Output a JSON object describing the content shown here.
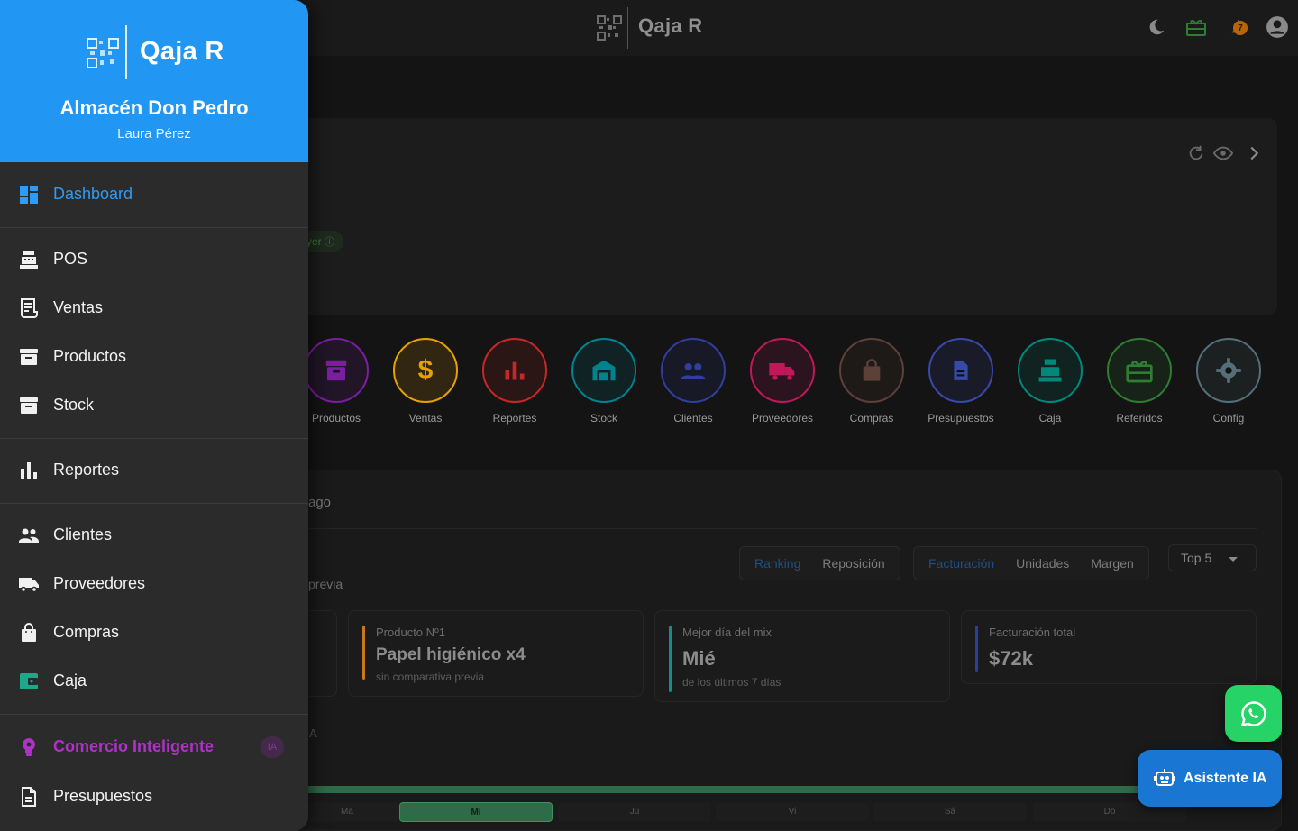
{
  "topbar": {
    "title": "Qaja R",
    "icons": [
      "moon-icon",
      "gift-icon",
      "bell-icon",
      "account-icon"
    ],
    "notifications_count": "7"
  },
  "background": {
    "summary_card": {
      "comparison_pill": "yer",
      "controls": [
        "refresh-icon",
        "eye-icon",
        "chevron-right-icon"
      ]
    },
    "quick_access": [
      {
        "label": "Productos",
        "color": "#7b1fa2"
      },
      {
        "label": "Ventas",
        "color": "#e6a100"
      },
      {
        "label": "Reportes",
        "color": "#c62828"
      },
      {
        "label": "Stock",
        "color": "#00838f"
      },
      {
        "label": "Clientes",
        "color": "#303f9f"
      },
      {
        "label": "Proveedores",
        "color": "#c2185b"
      },
      {
        "label": "Compras",
        "color": "#5d4037"
      },
      {
        "label": "Presupuestos",
        "color": "#3949ab"
      },
      {
        "label": "Caja",
        "color": "#00897b"
      },
      {
        "label": "Referidos",
        "color": "#2e7d32"
      },
      {
        "label": "Config",
        "color": "#546e7a"
      }
    ],
    "analytics": {
      "title_fragment": "ago",
      "subtitle_fragment": "previa",
      "view_tabs": [
        {
          "label": "Ranking",
          "active": true
        },
        {
          "label": "Reposición",
          "active": false
        }
      ],
      "metric_tabs": [
        {
          "label": "Facturación",
          "active": true
        },
        {
          "label": "Unidades",
          "active": false
        },
        {
          "label": "Margen",
          "active": false
        }
      ],
      "top_select": "Top 5",
      "kpis": [
        {
          "label": "Producto Nº1",
          "value": "Papel higiénico x4",
          "note": "sin comparativa previa",
          "accent": "#c77a1a"
        },
        {
          "label": "Mejor día del mix",
          "value": "Mié",
          "note": "de los últimos 7 días",
          "accent": "#1a8a8a"
        },
        {
          "label": "Facturación total",
          "value": "$72k",
          "note": "",
          "accent": "#2a3fa0"
        }
      ],
      "stray_letter": "A",
      "days": [
        {
          "label": "Ma",
          "active": false
        },
        {
          "label": "Mi",
          "active": true
        },
        {
          "label": "Ju",
          "active": false
        },
        {
          "label": "Vi",
          "active": false
        },
        {
          "label": "Sá",
          "active": false
        },
        {
          "label": "Do",
          "active": false
        }
      ]
    }
  },
  "fab": {
    "whatsapp_icon": "whatsapp-icon",
    "assistant_label": "Asistente IA"
  },
  "drawer": {
    "brand": "Qaja R",
    "store_name": "Almacén Don Pedro",
    "user_name": "Laura Pérez",
    "items": [
      {
        "label": "Dashboard",
        "icon": "dashboard-icon",
        "active": true
      },
      {
        "label": "POS",
        "icon": "register-icon"
      },
      {
        "label": "Ventas",
        "icon": "receipt-icon"
      },
      {
        "label": "Productos",
        "icon": "archive-icon"
      },
      {
        "label": "Stock",
        "icon": "archive-icon"
      },
      {
        "label": "Reportes",
        "icon": "bar-chart-icon"
      },
      {
        "label": "Clientes",
        "icon": "people-icon"
      },
      {
        "label": "Proveedores",
        "icon": "truck-icon"
      },
      {
        "label": "Compras",
        "icon": "shopping-bag-icon"
      },
      {
        "label": "Caja",
        "icon": "wallet-icon"
      },
      {
        "label": "Comercio Inteligente",
        "icon": "bulb-icon",
        "badge": "IA"
      },
      {
        "label": "Presupuestos",
        "icon": "document-icon"
      }
    ],
    "colors": {
      "header": "#2196f3",
      "active": "#2e9bf5",
      "ia": "#b031c8",
      "caja_icon": "#1ea88a"
    }
  }
}
